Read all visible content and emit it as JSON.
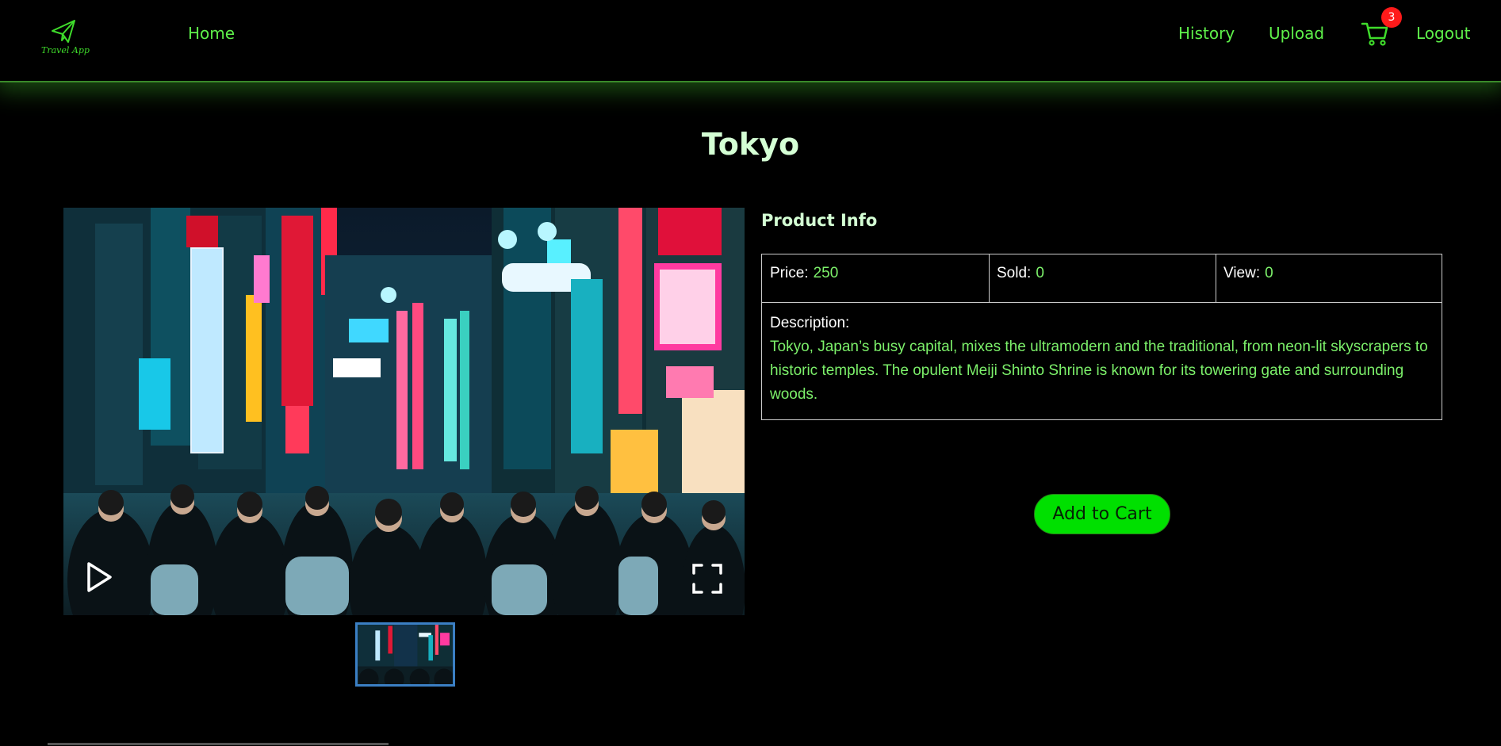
{
  "nav": {
    "logo_text": "Travel App",
    "home_label": "Home",
    "history_label": "History",
    "upload_label": "Upload",
    "cart_count": "3",
    "logout_label": "Logout"
  },
  "product": {
    "title": "Tokyo",
    "info_heading": "Product Info",
    "price_label": "Price:",
    "price_value": "250",
    "sold_label": "Sold:",
    "sold_value": "0",
    "view_label": "View:",
    "view_value": "0",
    "description_label": "Description:",
    "description_text": "Tokyo, Japan’s busy capital, mixes the ultramodern and the traditional, from neon-lit skyscrapers to historic temples. The opulent Meiji Shinto Shrine is known for its towering gate and surrounding woods.",
    "add_to_cart_label": "Add to Cart"
  },
  "icons": {
    "logo": "paper-plane-icon",
    "cart": "shopping-cart-icon",
    "play": "play-icon",
    "fullscreen": "fullscreen-icon"
  },
  "colors": {
    "accent_green": "#5ef04a",
    "button_green": "#00e000",
    "badge_red": "#ff1a1a",
    "thumb_border": "#3b7fc4"
  }
}
